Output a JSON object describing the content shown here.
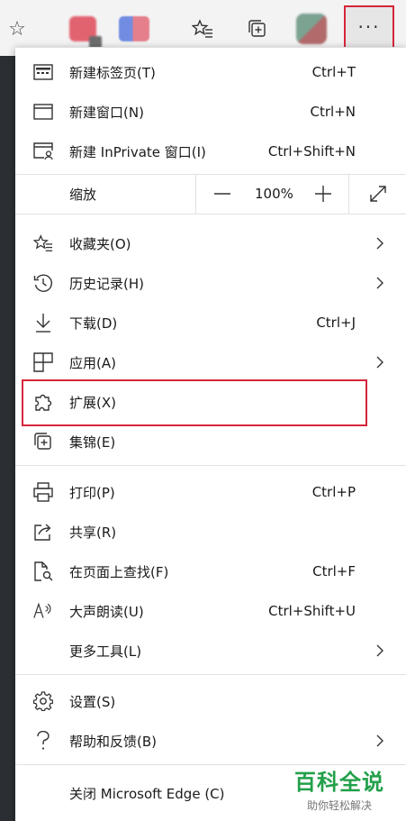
{
  "toolbar": {
    "more_label": "···"
  },
  "zoom": {
    "label": "缩放",
    "value": "100%"
  },
  "menu_items": [
    {
      "label": "新建标签页(T)",
      "shortcut": "Ctrl+T"
    },
    {
      "label": "新建窗口(N)",
      "shortcut": "Ctrl+N"
    },
    {
      "label": "新建 InPrivate 窗口(I)",
      "shortcut": "Ctrl+Shift+N"
    },
    {
      "label": "收藏夹(O)"
    },
    {
      "label": "历史记录(H)"
    },
    {
      "label": "下载(D)",
      "shortcut": "Ctrl+J"
    },
    {
      "label": "应用(A)"
    },
    {
      "label": "扩展(X)"
    },
    {
      "label": "集锦(E)"
    },
    {
      "label": "打印(P)",
      "shortcut": "Ctrl+P"
    },
    {
      "label": "共享(R)"
    },
    {
      "label": "在页面上查找(F)",
      "shortcut": "Ctrl+F"
    },
    {
      "label": "大声朗读(U)",
      "shortcut": "Ctrl+Shift+U"
    },
    {
      "label": "更多工具(L)"
    },
    {
      "label": "设置(S)"
    },
    {
      "label": "帮助和反馈(B)"
    },
    {
      "label": "关闭 Microsoft Edge (C)"
    }
  ],
  "watermark": {
    "main": "百科全说",
    "sub": "助你轻松解决"
  },
  "colors": {
    "highlight": "#d6253b",
    "watermark": "#22a04a"
  }
}
